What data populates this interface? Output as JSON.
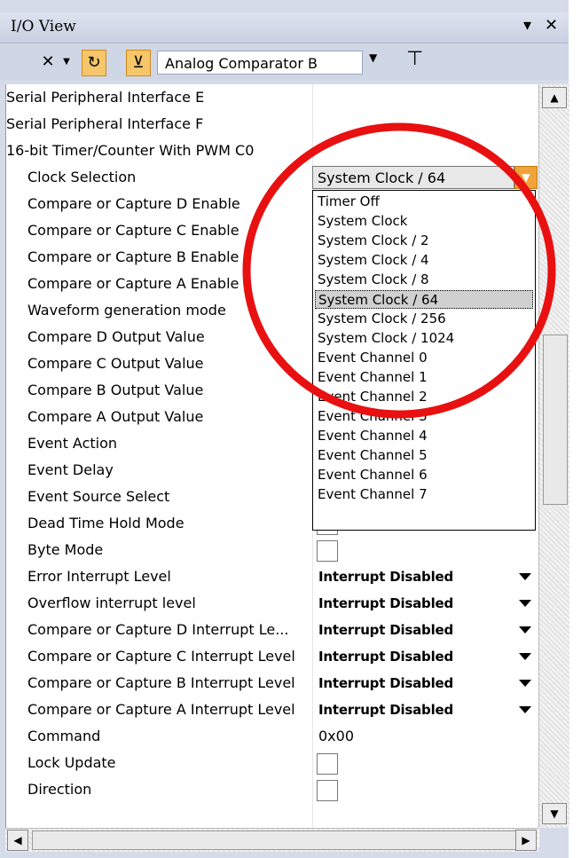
{
  "window": {
    "title": "I/O View"
  },
  "toolbar": {
    "module_select": "Analog Comparator B"
  },
  "rows": [
    {
      "name": "Serial Peripheral Interface E"
    },
    {
      "name": "Serial Peripheral Interface F"
    },
    {
      "name": "16-bit Timer/Counter With PWM C0"
    },
    {
      "name": "Clock Selection",
      "value": "System Clock / 64"
    },
    {
      "name": "Compare or Capture D Enable"
    },
    {
      "name": "Compare or Capture C Enable"
    },
    {
      "name": "Compare or Capture B Enable"
    },
    {
      "name": "Compare or Capture A Enable"
    },
    {
      "name": "Waveform generation mode"
    },
    {
      "name": "Compare D Output Value"
    },
    {
      "name": "Compare C Output Value"
    },
    {
      "name": "Compare B Output Value"
    },
    {
      "name": "Compare A Output Value"
    },
    {
      "name": "Event Action"
    },
    {
      "name": "Event Delay"
    },
    {
      "name": "Event Source Select"
    },
    {
      "name": "Dead Time Hold Mode"
    },
    {
      "name": "Byte Mode"
    },
    {
      "name": "Error Interrupt Level",
      "value": "Interrupt Disabled"
    },
    {
      "name": "Overflow interrupt level",
      "value": "Interrupt Disabled"
    },
    {
      "name": "Compare or Capture D Interrupt Le...",
      "value": "Interrupt Disabled"
    },
    {
      "name": "Compare or Capture C Interrupt Level",
      "value": "Interrupt Disabled"
    },
    {
      "name": "Compare or Capture B Interrupt Level",
      "value": "Interrupt Disabled"
    },
    {
      "name": "Compare or Capture A Interrupt Level",
      "value": "Interrupt Disabled"
    },
    {
      "name": "Command",
      "value": "0x00"
    },
    {
      "name": "Lock Update"
    },
    {
      "name": "Direction"
    }
  ],
  "clock_options": [
    "Timer Off",
    "System Clock",
    "System Clock / 2",
    "System Clock / 4",
    "System Clock / 8",
    "System Clock / 64",
    "System Clock / 256",
    "System Clock / 1024",
    "Event Channel 0",
    "Event Channel 1",
    "Event Channel 2",
    "Event Channel 3",
    "Event Channel 4",
    "Event Channel 5",
    "Event Channel 6",
    "Event Channel 7"
  ],
  "annotation_color": "#e81010"
}
